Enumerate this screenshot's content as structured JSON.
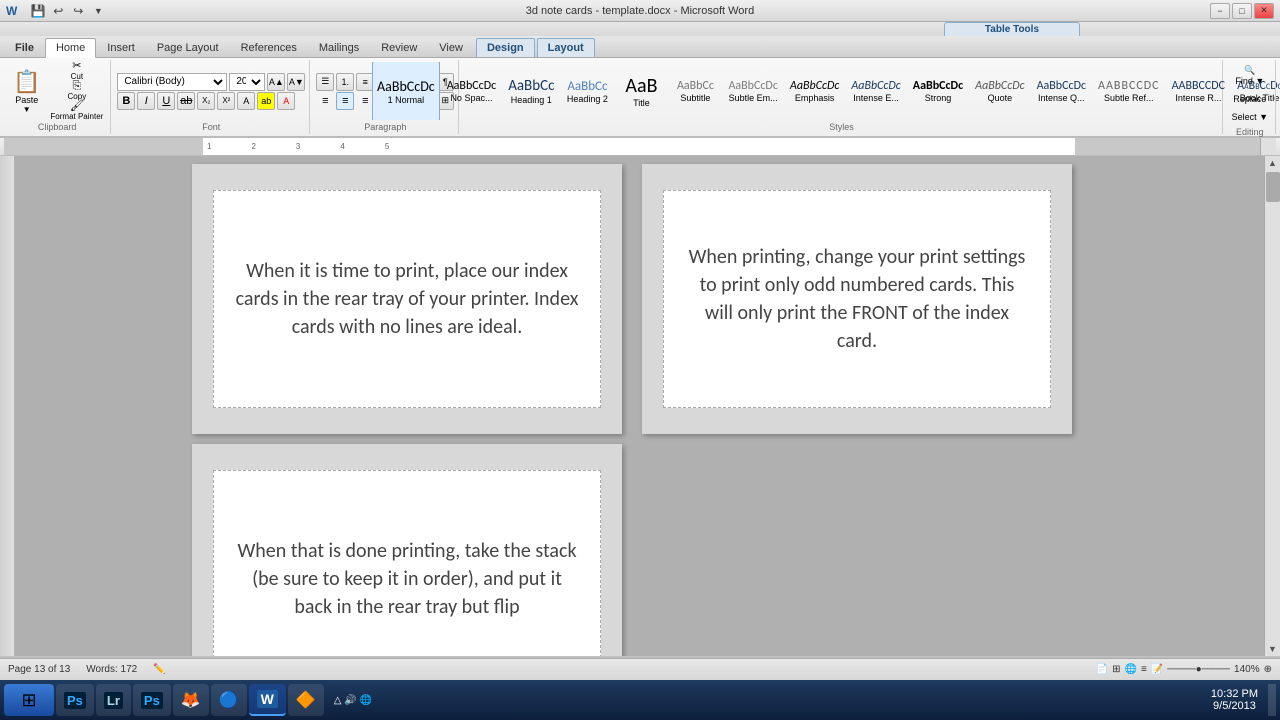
{
  "titlebar": {
    "title": "3d note cards - template.docx - Microsoft Word",
    "minimize": "−",
    "restore": "□",
    "close": "✕"
  },
  "ribbon_tab_group": "Table Tools",
  "ribbon_tabs": [
    {
      "label": "File",
      "active": false
    },
    {
      "label": "Home",
      "active": true
    },
    {
      "label": "Insert",
      "active": false
    },
    {
      "label": "Page Layout",
      "active": false
    },
    {
      "label": "References",
      "active": false
    },
    {
      "label": "Mailings",
      "active": false
    },
    {
      "label": "Review",
      "active": false
    },
    {
      "label": "View",
      "active": false
    },
    {
      "label": "Design",
      "active": false
    },
    {
      "label": "Layout",
      "active": false
    }
  ],
  "font": {
    "name": "Calibri (Body)",
    "size": "20"
  },
  "styles": [
    {
      "label": "1 Normal",
      "preview": "AaBbCcDc",
      "active": true
    },
    {
      "label": "No Spac...",
      "preview": "AaBbCcDc"
    },
    {
      "label": "Heading 1",
      "preview": "AaBbCc"
    },
    {
      "label": "Heading 2",
      "preview": "AaBbCc"
    },
    {
      "label": "Title",
      "preview": "AaB"
    },
    {
      "label": "Subtitle",
      "preview": "AaBbCc"
    },
    {
      "label": "Subtle Em...",
      "preview": "AaBbCcDc"
    },
    {
      "label": "Emphasis",
      "preview": "AaBbCcDc"
    },
    {
      "label": "Intense E...",
      "preview": "AaBbCcDc"
    },
    {
      "label": "Strong",
      "preview": "AaBbCcDc"
    },
    {
      "label": "Quote",
      "preview": "AaBbCcDc"
    },
    {
      "label": "Intense Q...",
      "preview": "AaBbCcDc"
    },
    {
      "label": "Subtle Ref...",
      "preview": "AaBbCcDc"
    },
    {
      "label": "Intense R...",
      "preview": "AaBbCcDc"
    },
    {
      "label": "Book Title",
      "preview": "AaBbCcDc"
    }
  ],
  "cards": [
    {
      "id": "card1",
      "text": "When it is time to print, place our index cards in the rear tray of your printer.  Index cards with no lines are ideal."
    },
    {
      "id": "card2",
      "text": "When printing, change your print settings to print only odd numbered cards.  This will only print the FRONT of the index card."
    },
    {
      "id": "card3",
      "text": "When that is done printing,  take the stack (be sure to keep it in order), and put it back in the rear tray but flip"
    }
  ],
  "statusbar": {
    "page": "Page 13 of 13",
    "words": "Words: 172",
    "zoom": "140%"
  },
  "taskbar": {
    "time": "10:32 PM",
    "date": "9/5/2013"
  },
  "taskbar_items": [
    {
      "label": "",
      "icon": "⊞"
    },
    {
      "label": "Adobe PS",
      "icon": "🅟"
    },
    {
      "label": "Lr",
      "icon": "Lr"
    },
    {
      "label": "Photoshop",
      "icon": "Ps"
    },
    {
      "label": "Firefox",
      "icon": "🦊"
    },
    {
      "label": "Chrome",
      "icon": "⬤"
    },
    {
      "label": "Word",
      "icon": "W"
    },
    {
      "label": "VLC",
      "icon": "▶"
    }
  ]
}
